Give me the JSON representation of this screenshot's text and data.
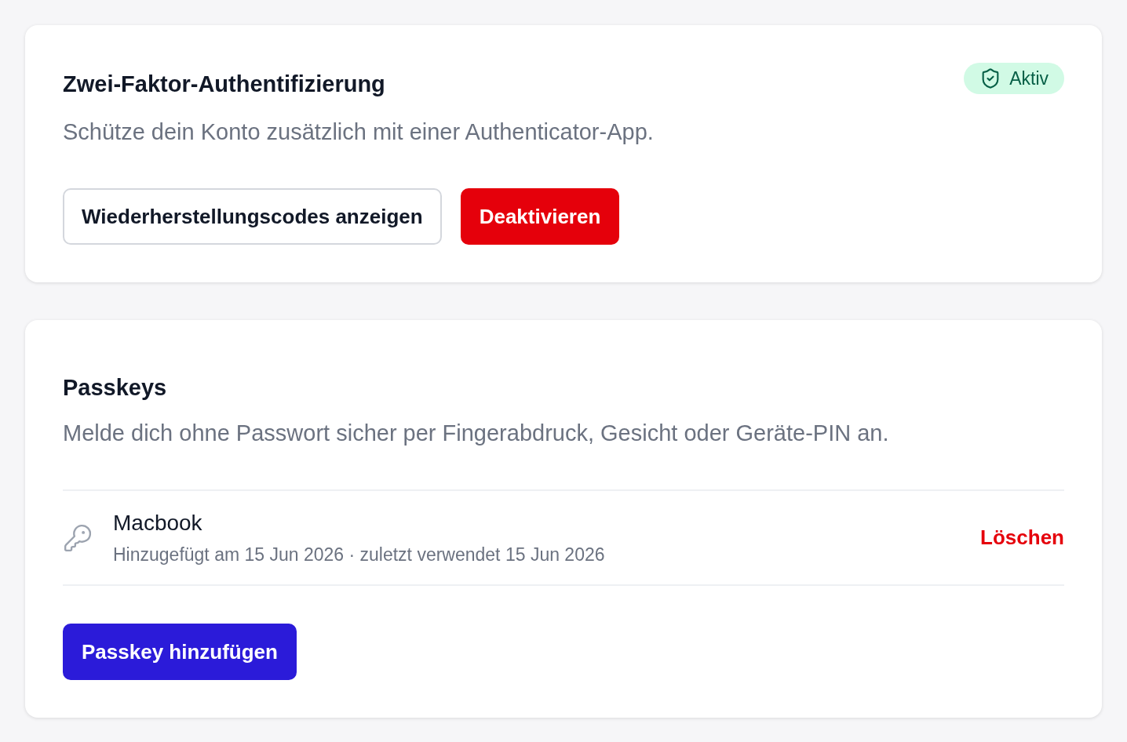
{
  "two_factor": {
    "title": "Zwei-Faktor-Authentifizierung",
    "description": "Schütze dein Konto zusätzlich mit einer Authenticator-App.",
    "status_badge": {
      "label": "Aktiv",
      "kind": "success"
    },
    "buttons": [
      {
        "label": "Wiederherstellungscodes anzeigen",
        "kind": "secondary"
      },
      {
        "label": "Deaktivieren",
        "kind": "danger"
      }
    ]
  },
  "passkeys": {
    "title": "Passkeys",
    "description": "Melde dich ohne Passwort sicher per Fingerabdruck, Gesicht oder Geräte-PIN an.",
    "items": [
      {
        "name": "Macbook",
        "meta": "Hinzugefügt am 15 Jun 2026 · zuletzt verwendet 15 Jun 2026",
        "action": "Löschen"
      }
    ],
    "add_button": {
      "label": "Passkey hinzufügen",
      "kind": "primary"
    }
  }
}
